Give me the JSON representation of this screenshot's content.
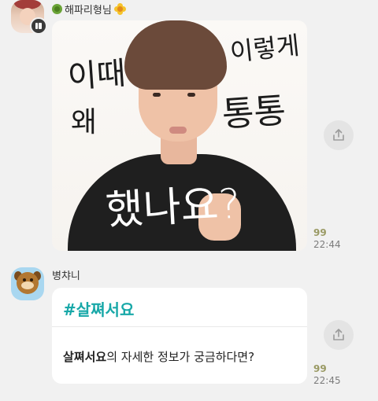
{
  "message1": {
    "sender_name": "해파리형님",
    "sender_emoji_left": "virus-emoji",
    "sender_emoji_right": "sunflower-emoji",
    "photo_text": {
      "line1": "이때",
      "line2": "왜",
      "line3": "이렇게",
      "line4": "통통",
      "line5": "했나요?"
    },
    "read_count": "99",
    "time": "22:44"
  },
  "message2": {
    "sender_name": "병챠니",
    "card_hashtag": "#살쪄서요",
    "card_desc_bold": "살쪄서요",
    "card_desc_rest": "의 자세한 정보가 궁금하다면?",
    "read_count": "99",
    "time": "22:45"
  },
  "colors": {
    "background": "#f1f1f1",
    "hashtag": "#18a8a8",
    "read_count": "#9a9a64"
  },
  "icons": [
    "share-icon",
    "profile-badge-icon"
  ]
}
